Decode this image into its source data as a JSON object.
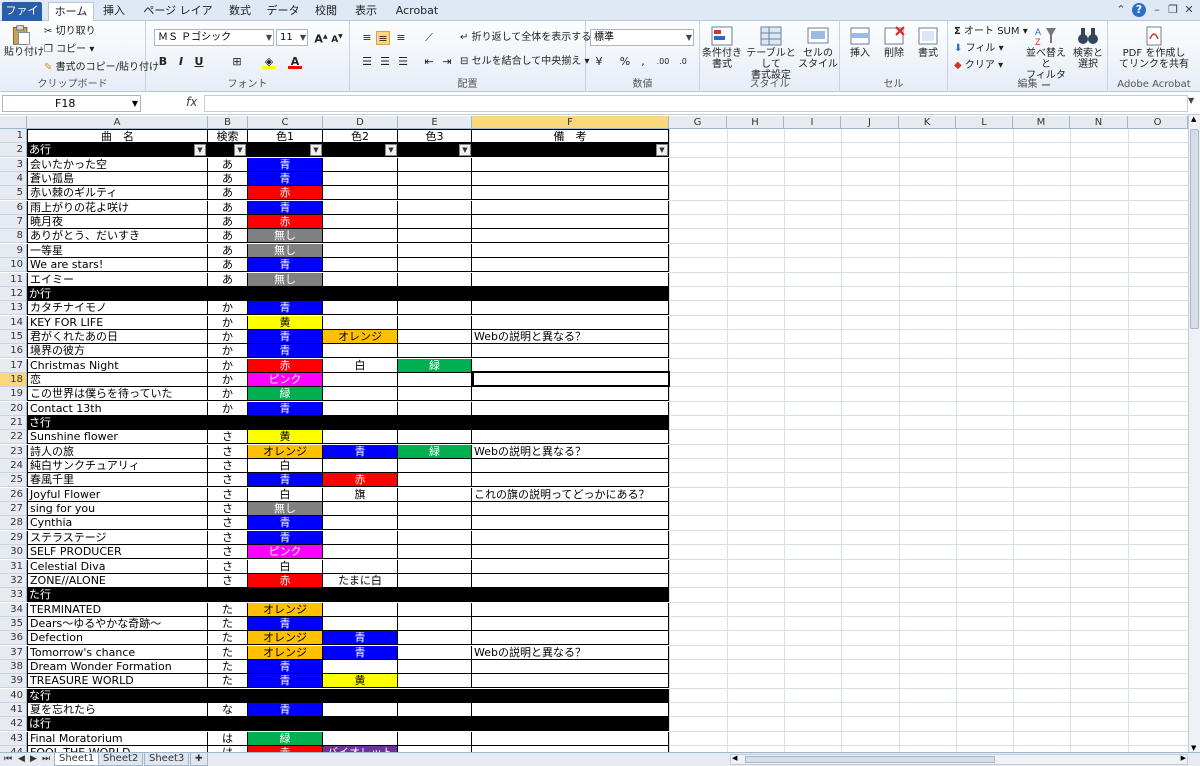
{
  "ribbon_tabs": [
    "ファイル",
    "ホーム",
    "挿入",
    "ページ レイアウト",
    "数式",
    "データ",
    "校閲",
    "表示",
    "Acrobat"
  ],
  "clipboard": {
    "paste": "貼り付け",
    "cut": "切り取り",
    "copy": "コピー ▾",
    "format_painter": "書式のコピー/貼り付け",
    "label": "クリップボード"
  },
  "font": {
    "name": "ＭＳ Ｐゴシック",
    "size": "11",
    "bold": "B",
    "italic": "I",
    "underline": "U",
    "label": "フォント"
  },
  "alignment": {
    "wrap": "折り返して全体を表示する",
    "merge": "セルを結合して中央揃え",
    "label": "配置"
  },
  "number": {
    "format": "標準",
    "label": "数値"
  },
  "styles": {
    "conditional": "条件付き\n書式",
    "table": "テーブルとして\n書式設定",
    "cellstyle": "セルの\nスタイル",
    "label": "スタイル"
  },
  "cells": {
    "insert": "挿入",
    "delete": "削除",
    "format": "書式",
    "label": "セル"
  },
  "editing": {
    "autosum": "オート SUM",
    "fill": "フィル",
    "clear": "クリア",
    "sort": "並べ替えと\nフィルター",
    "find": "検索と\n選択",
    "label": "編集"
  },
  "acrobat": {
    "pdf": "PDF を作成し\nてリンクを共有",
    "label": "Adobe Acrobat"
  },
  "namebox": "F18",
  "fx": "fx",
  "columns": [
    "A",
    "B",
    "C",
    "D",
    "E",
    "F",
    "G",
    "H",
    "I",
    "J",
    "K",
    "L",
    "M",
    "N",
    "O"
  ],
  "header": {
    "title": "曲　名",
    "search": "検索",
    "color1": "色1",
    "color2": "色2",
    "color3": "色3",
    "notes": "備　考"
  },
  "rows": [
    {
      "n": "2",
      "section": "あ行"
    },
    {
      "n": "3",
      "title": "会いたかった空",
      "k": "あ",
      "c1": "青"
    },
    {
      "n": "4",
      "title": "蒼い孤島",
      "k": "あ",
      "c1": "青"
    },
    {
      "n": "5",
      "title": "赤い棘のギルティ",
      "k": "あ",
      "c1": "赤"
    },
    {
      "n": "6",
      "title": "雨上がりの花よ咲け",
      "k": "あ",
      "c1": "青"
    },
    {
      "n": "7",
      "title": "暁月夜",
      "k": "あ",
      "c1": "赤"
    },
    {
      "n": "8",
      "title": "ありがとう、だいすき",
      "k": "あ",
      "c1": "無し"
    },
    {
      "n": "9",
      "title": "一等星",
      "k": "あ",
      "c1": "無し"
    },
    {
      "n": "10",
      "title": "We are stars!",
      "k": "あ",
      "c1": "青"
    },
    {
      "n": "11",
      "title": "エイミー",
      "k": "あ",
      "c1": "無し"
    },
    {
      "n": "12",
      "section": "か行"
    },
    {
      "n": "13",
      "title": "カタチナイモノ",
      "k": "か",
      "c1": "青"
    },
    {
      "n": "14",
      "title": "KEY FOR LIFE",
      "k": "か",
      "c1": "黄"
    },
    {
      "n": "15",
      "title": "君がくれたあの日",
      "k": "か",
      "c1": "青",
      "c2": "オレンジ",
      "note": "Webの説明と異なる？"
    },
    {
      "n": "16",
      "title": "境界の彼方",
      "k": "か",
      "c1": "青"
    },
    {
      "n": "17",
      "title": "Christmas Night",
      "k": "か",
      "c1": "赤",
      "c2": "白",
      "c3": "緑"
    },
    {
      "n": "18",
      "title": "恋",
      "k": "か",
      "c1": "ピンク"
    },
    {
      "n": "19",
      "title": "この世界は僕らを待っていた",
      "k": "か",
      "c1": "緑"
    },
    {
      "n": "20",
      "title": "Contact 13th",
      "k": "か",
      "c1": "青"
    },
    {
      "n": "21",
      "section": "さ行"
    },
    {
      "n": "22",
      "title": "Sunshine flower",
      "k": "さ",
      "c1": "黄"
    },
    {
      "n": "23",
      "title": "詩人の旅",
      "k": "さ",
      "c1": "オレンジ",
      "c2": "青",
      "c3": "緑",
      "note": "Webの説明と異なる？"
    },
    {
      "n": "24",
      "title": "純白サンクチュアリィ",
      "k": "さ",
      "c1": "白"
    },
    {
      "n": "25",
      "title": "春風千里",
      "k": "さ",
      "c1": "青",
      "c2": "赤"
    },
    {
      "n": "26",
      "title": "Joyful Flower",
      "k": "さ",
      "c1": "白",
      "c2": "旗",
      "note": "これの旗の説明ってどっかにある？"
    },
    {
      "n": "27",
      "title": "sing for you",
      "k": "さ",
      "c1": "無し"
    },
    {
      "n": "28",
      "title": "Cynthia",
      "k": "さ",
      "c1": "青"
    },
    {
      "n": "29",
      "title": "ステラステージ",
      "k": "さ",
      "c1": "青"
    },
    {
      "n": "30",
      "title": "SELF PRODUCER",
      "k": "さ",
      "c1": "ピンク"
    },
    {
      "n": "31",
      "title": "Celestial Diva",
      "k": "さ",
      "c1": "白"
    },
    {
      "n": "32",
      "title": "ZONE//ALONE",
      "k": "さ",
      "c1": "赤",
      "c2": "たまに白"
    },
    {
      "n": "33",
      "section": "た行"
    },
    {
      "n": "34",
      "title": "TERMINATED",
      "k": "た",
      "c1": "オレンジ"
    },
    {
      "n": "35",
      "title": "Dears～ゆるやかな奇跡～",
      "k": "た",
      "c1": "青"
    },
    {
      "n": "36",
      "title": "Defection",
      "k": "た",
      "c1": "オレンジ",
      "c2": "青"
    },
    {
      "n": "37",
      "title": "Tomorrow's chance",
      "k": "た",
      "c1": "オレンジ",
      "c2": "青",
      "note": "Webの説明と異なる？"
    },
    {
      "n": "38",
      "title": "Dream Wonder Formation",
      "k": "た",
      "c1": "青"
    },
    {
      "n": "39",
      "title": "TREASURE WORLD",
      "k": "た",
      "c1": "青",
      "c2": "黄"
    },
    {
      "n": "40",
      "section": "な行"
    },
    {
      "n": "41",
      "title": "夏を忘れたら",
      "k": "な",
      "c1": "青"
    },
    {
      "n": "42",
      "section": "は行"
    },
    {
      "n": "43",
      "title": "Final Moratorium",
      "k": "は",
      "c1": "緑"
    },
    {
      "n": "44",
      "title": "FOOL THE WORLD",
      "k": "は",
      "c1": "赤",
      "c2": "バイオレット"
    }
  ],
  "fill_colors": {
    "青": "#0000ff",
    "赤": "#ff0000",
    "無し": "#808080",
    "黄": "#ffff00",
    "オレンジ": "#ffc000",
    "緑": "#00b050",
    "ピンク": "#ff00ff",
    "白": "#ffffff",
    "バイオレット": "#7030a0",
    "旗": "#ffffff",
    "たまに白": "#ffffff"
  },
  "dark_text_colors": [
    "黄",
    "オレンジ",
    "白",
    "旗",
    "たまに白"
  ],
  "sheets": [
    "Sheet1",
    "Sheet2",
    "Sheet3"
  ],
  "selected_cell": "F18"
}
